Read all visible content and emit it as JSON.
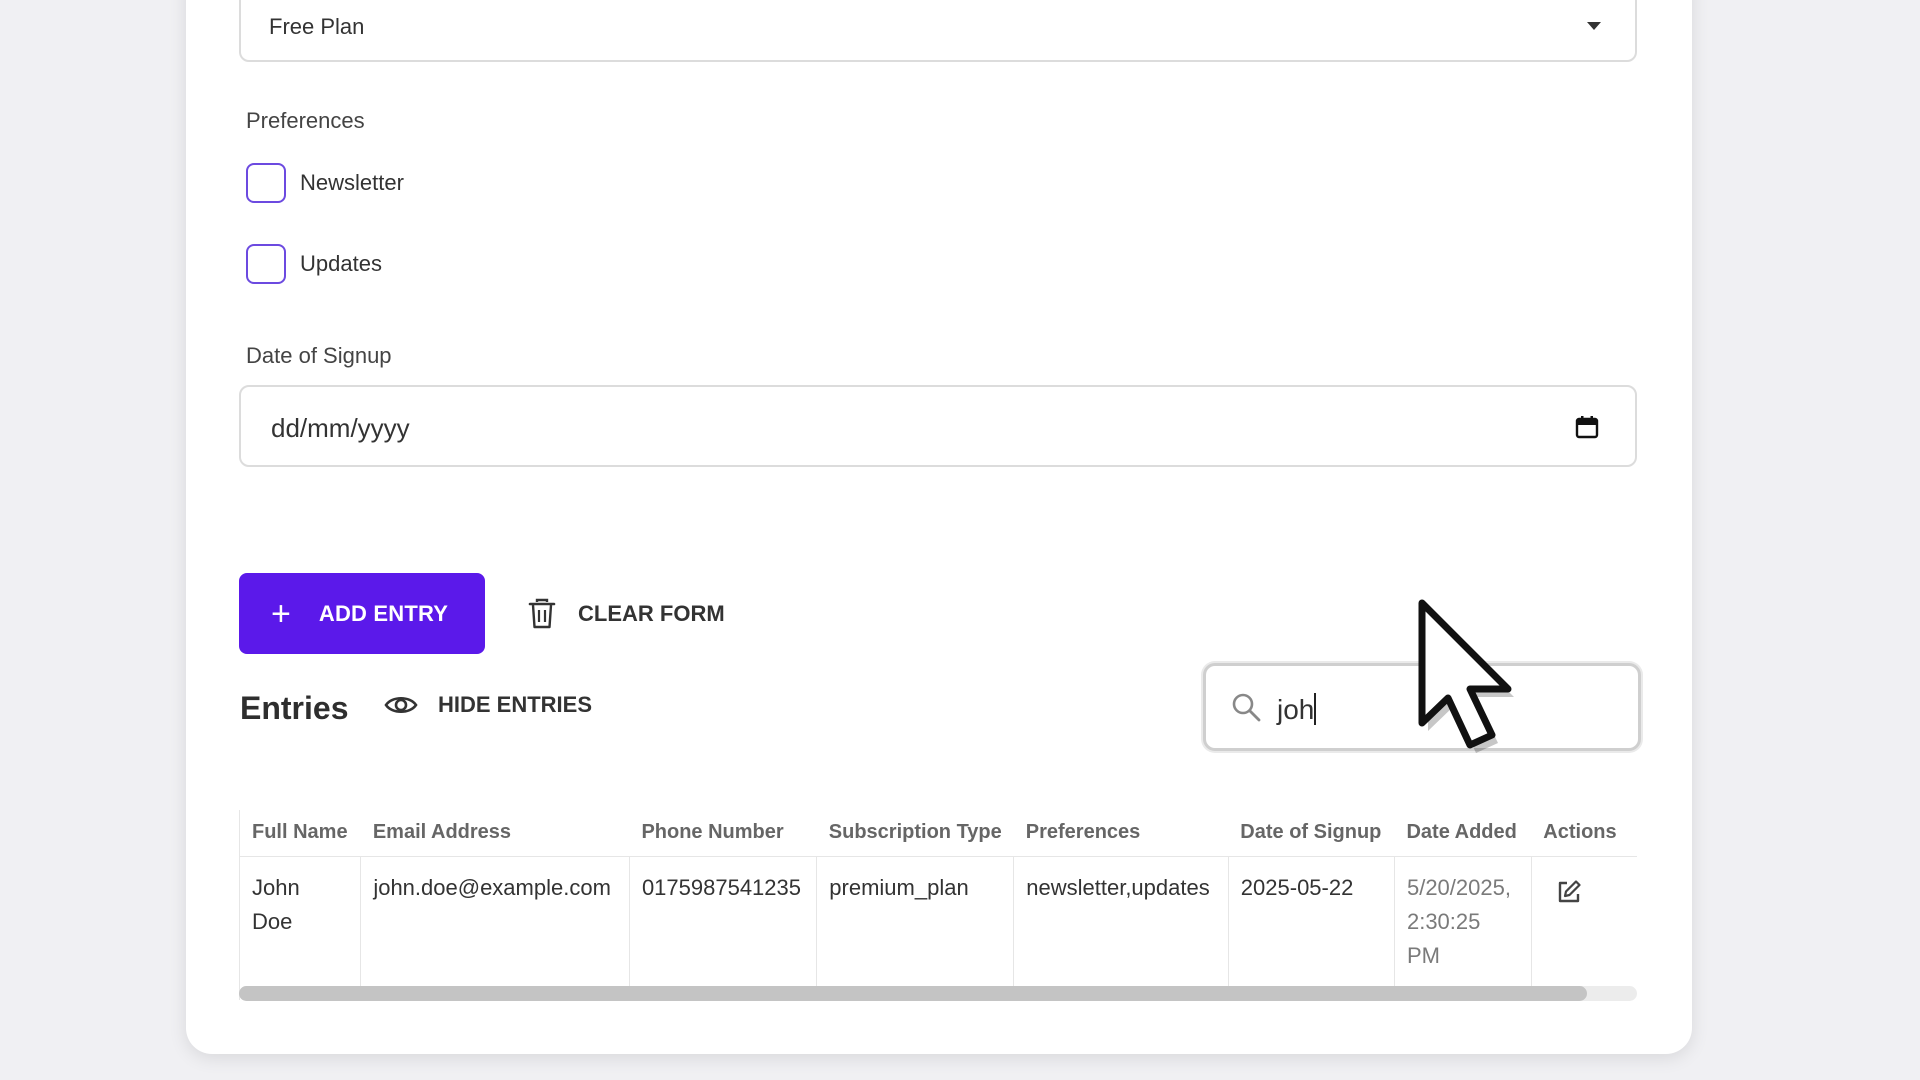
{
  "form": {
    "subscription_select": {
      "value": "Free Plan"
    },
    "preferences": {
      "label": "Preferences",
      "options": [
        {
          "label": "Newsletter",
          "checked": false
        },
        {
          "label": "Updates",
          "checked": false
        }
      ]
    },
    "date_of_signup": {
      "label": "Date of Signup",
      "placeholder": "dd/mm/yyyy"
    },
    "add_entry_label": "ADD ENTRY",
    "clear_form_label": "CLEAR FORM"
  },
  "entries": {
    "title": "Entries",
    "hide_label": "HIDE ENTRIES",
    "search_value": "joh",
    "columns": [
      "Full Name",
      "Email Address",
      "Phone Number",
      "Subscription Type",
      "Preferences",
      "Date of Signup",
      "Date Added",
      "Actions"
    ],
    "rows": [
      {
        "full_name_line1": "John",
        "full_name_line2": "Doe",
        "email": "john.doe@example.com",
        "phone": "0175987541235",
        "subscription": "premium_plan",
        "preferences": "newsletter,updates",
        "date_of_signup": "2025-05-22",
        "date_added_line1": "5/20/2025,",
        "date_added_line2": "2:30:25",
        "date_added_line3": "PM",
        "action_icon": "edit-icon"
      }
    ]
  },
  "colors": {
    "accent": "#5b19ea",
    "checkbox_border": "#6c4ae0",
    "page_bg": "#f0f0f3"
  }
}
